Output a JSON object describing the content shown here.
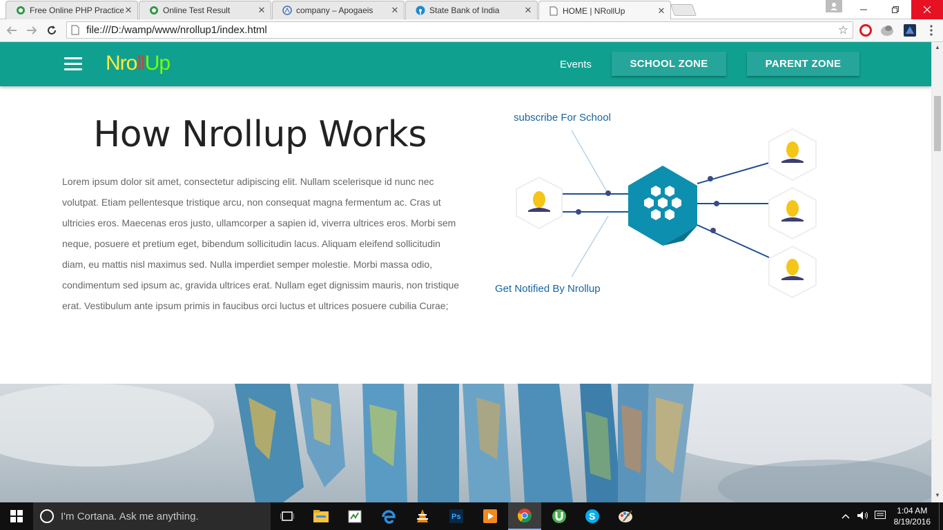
{
  "browser": {
    "tabs": [
      {
        "title": "Free Online PHP Practice T",
        "active": false
      },
      {
        "title": "Online Test Result",
        "active": false
      },
      {
        "title": "company – Apogaeis",
        "active": false
      },
      {
        "title": "State Bank of India",
        "active": false
      },
      {
        "title": "HOME | NRollUp",
        "active": true
      }
    ],
    "close_glyph": "✕",
    "url": "file:///D:/wamp/www/nrollup1/index.html"
  },
  "site": {
    "logo": {
      "part1": "Nro",
      "part2": "ll",
      "part3": "Up"
    },
    "nav": {
      "events": "Events",
      "school_zone": "SCHOOL ZONE",
      "parent_zone": "PARENT ZONE"
    },
    "colors": {
      "nav_bg": "#10a090",
      "button_bg": "#26a69a",
      "hub": "#0d8fb0"
    },
    "how": {
      "title": "How Nrollup Works",
      "body": "Lorem ipsum dolor sit amet, consectetur adipiscing elit. Nullam scelerisque id nunc nec volutpat. Etiam pellentesque tristique arcu, non consequat magna fermentum ac. Cras ut ultricies eros. Maecenas eros justo, ullamcorper a sapien id, viverra ultrices eros. Morbi sem neque, posuere et pretium eget, bibendum sollicitudin lacus. Aliquam eleifend sollicitudin diam, eu mattis nisl maximus sed. Nulla imperdiet semper molestie. Morbi massa odio, condimentum sed ipsum ac, gravida ultrices erat. Nullam eget dignissim mauris, non tristique erat. Vestibulum ante ipsum primis in faucibus orci luctus et ultrices posuere cubilia Curae;"
    },
    "diagram": {
      "label_top": "subscribe For School",
      "label_bottom": "Get Notified By Nrollup"
    }
  },
  "taskbar": {
    "cortana_placeholder": "I'm Cortana. Ask me anything.",
    "time": "1:04 AM",
    "date": "8/19/2016",
    "icons": [
      "task-view-icon",
      "file-explorer-icon",
      "notepad-icon",
      "edge-icon",
      "vlc-icon",
      "photoshop-icon",
      "media-player-icon",
      "chrome-icon",
      "utorrent-icon",
      "skype-icon",
      "paint-icon"
    ]
  }
}
